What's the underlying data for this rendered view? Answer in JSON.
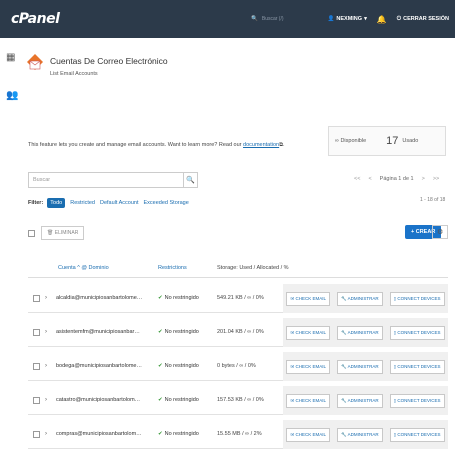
{
  "topbar": {
    "logo": "cPanel",
    "search_placeholder": "Buscar (/)",
    "user": "NEXMING",
    "logout": "CERRAR SESIÓN"
  },
  "sidebar": {
    "icons": [
      "grid-icon",
      "users-icon"
    ]
  },
  "header": {
    "title": "Cuentas De Correo Electrónico",
    "subtitle": "List Email Accounts",
    "description": "This feature lets you create and manage email accounts. Want to learn more? Read our",
    "doc_link": "documentation"
  },
  "stats": {
    "available_label": "∞ Disponible",
    "used_value": "17",
    "used_label": "Usado"
  },
  "search": {
    "placeholder": "Buscar"
  },
  "pager": {
    "first": "<<",
    "prev": "<",
    "page_text": "Página 1 de 1",
    "next": ">",
    "last": ">>",
    "count": "1 - 18 of 18"
  },
  "filters": {
    "label": "Filter:",
    "chips": [
      "Todo",
      "Restricted",
      "Default Account",
      "Exceeded Storage"
    ]
  },
  "toolbar": {
    "delete_label": "ELIMINAR",
    "create_label": "+ CREAR",
    "gear": "⚙"
  },
  "table": {
    "headers": {
      "account": "Cuenta ^ @ Dominio",
      "restrictions": "Restrictions",
      "storage": "Storage: Used / Allocated / %"
    },
    "rows": [
      {
        "account": "alcaldia@municipiosanbartolome…",
        "restriction": "No restringido",
        "storage": "549.21 KB / ∞ / 0%"
      },
      {
        "account": "asistentemfm@municipiosanbar…",
        "restriction": "No restringido",
        "storage": "201.04 KB / ∞ / 0%"
      },
      {
        "account": "bodega@municipiosanbartolome…",
        "restriction": "No restringido",
        "storage": "0 bytes / ∞ / 0%"
      },
      {
        "account": "catastro@municipiosanbartolom…",
        "restriction": "No restringido",
        "storage": "157.53 KB / ∞ / 0%"
      },
      {
        "account": "compras@municipiosanbartolom…",
        "restriction": "No restringido",
        "storage": "15.55 MB / ∞ / 2%"
      }
    ],
    "actions": {
      "check": "CHECK EMAIL",
      "manage": "ADMINISTRAR",
      "connect": "CONNECT DEVICES"
    }
  }
}
